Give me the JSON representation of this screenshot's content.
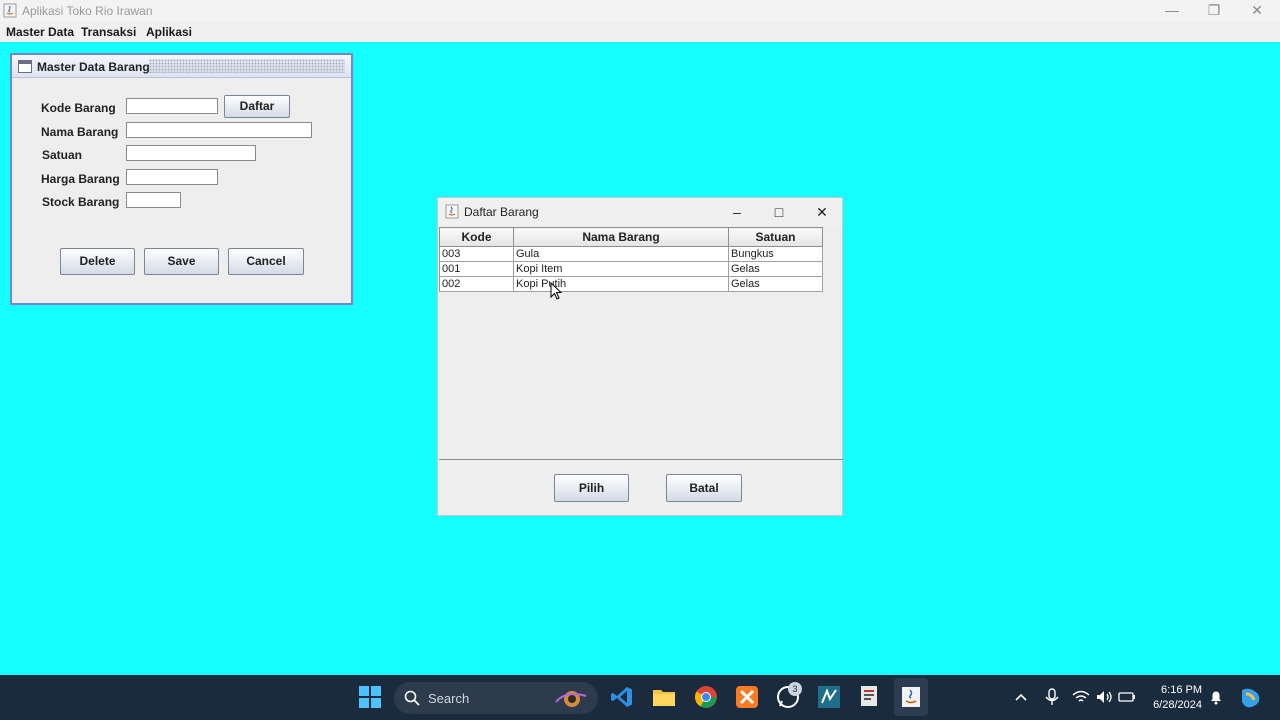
{
  "window": {
    "title": "Aplikasi Toko Rio Irawan",
    "minimize_icon": "minimize-icon",
    "restore_icon": "restore-icon",
    "close_icon": "close-icon"
  },
  "menubar": {
    "items": [
      "Master Data",
      "Transaksi",
      "Aplikasi"
    ]
  },
  "master_form": {
    "title": "Master Data Barang",
    "labels": {
      "kode": "Kode Barang",
      "nama": "Nama Barang",
      "satuan": "Satuan",
      "harga": "Harga Barang",
      "stock": "Stock Barang"
    },
    "values": {
      "kode": "",
      "nama": "",
      "satuan": "",
      "harga": "",
      "stock": ""
    },
    "buttons": {
      "daftar": "Daftar",
      "delete": "Delete",
      "save": "Save",
      "cancel": "Cancel"
    }
  },
  "dialog": {
    "title": "Daftar Barang",
    "columns": [
      "Kode",
      "Nama Barang",
      "Satuan"
    ],
    "rows": [
      [
        "003",
        "Gula",
        "Bungkus"
      ],
      [
        "001",
        "Kopi Item",
        "Gelas"
      ],
      [
        "002",
        "Kopi Putih",
        "Gelas"
      ]
    ],
    "buttons": {
      "pilih": "Pilih",
      "batal": "Batal"
    }
  },
  "taskbar": {
    "search_placeholder": "Search",
    "time": "6:16 PM",
    "date": "6/28/2024",
    "whatsapp_badge": "3"
  },
  "colors": {
    "desktop_background": "#16ffff",
    "taskbar": "#1b2b3e"
  }
}
